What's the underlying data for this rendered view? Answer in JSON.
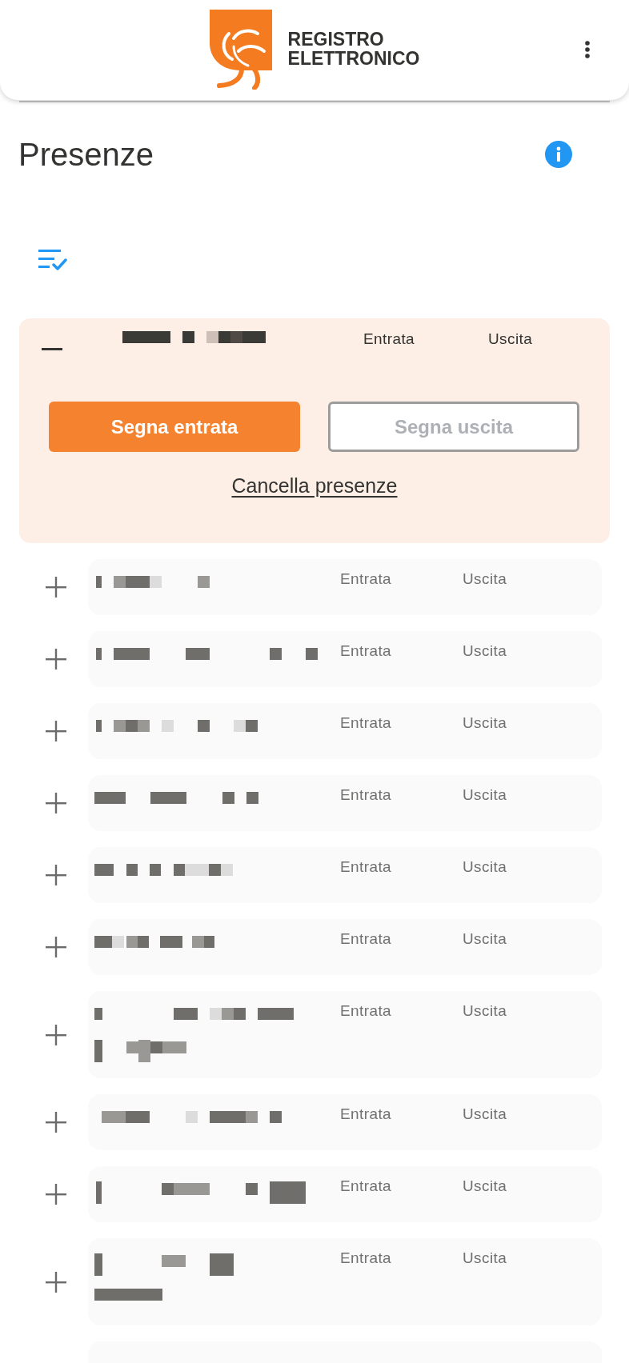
{
  "header": {
    "app_name": [
      "REGISTRO",
      "ELETTRONICO"
    ]
  },
  "page": {
    "title": "Presenze"
  },
  "students": [
    {
      "expanded": true,
      "kind": "short",
      "entry_label": "Entrata",
      "exit_label": "Uscita",
      "actions": {
        "mark_entry": {
          "label": "Segna entrata",
          "disabled": false
        },
        "mark_exit": {
          "label": "Segna uscita",
          "disabled": true
        },
        "clear": "Cancella presenze"
      }
    },
    {
      "expanded": false,
      "kind": "short",
      "entry_label": "Entrata",
      "exit_label": "Uscita"
    },
    {
      "expanded": false,
      "kind": "short",
      "entry_label": "Entrata",
      "exit_label": "Uscita"
    },
    {
      "expanded": false,
      "kind": "short",
      "entry_label": "Entrata",
      "exit_label": "Uscita"
    },
    {
      "expanded": false,
      "kind": "short",
      "entry_label": "Entrata",
      "exit_label": "Uscita"
    },
    {
      "expanded": false,
      "kind": "short",
      "entry_label": "Entrata",
      "exit_label": "Uscita"
    },
    {
      "expanded": false,
      "kind": "short",
      "entry_label": "Entrata",
      "exit_label": "Uscita"
    },
    {
      "expanded": false,
      "kind": "long",
      "entry_label": "Entrata",
      "exit_label": "Uscita"
    },
    {
      "expanded": false,
      "kind": "short",
      "entry_label": "Entrata",
      "exit_label": "Uscita"
    },
    {
      "expanded": false,
      "kind": "short",
      "entry_label": "Entrata",
      "exit_label": "Uscita"
    },
    {
      "expanded": false,
      "kind": "long",
      "entry_label": "Entrata",
      "exit_label": "Uscita"
    }
  ],
  "list": {
    "more_below": true
  }
}
